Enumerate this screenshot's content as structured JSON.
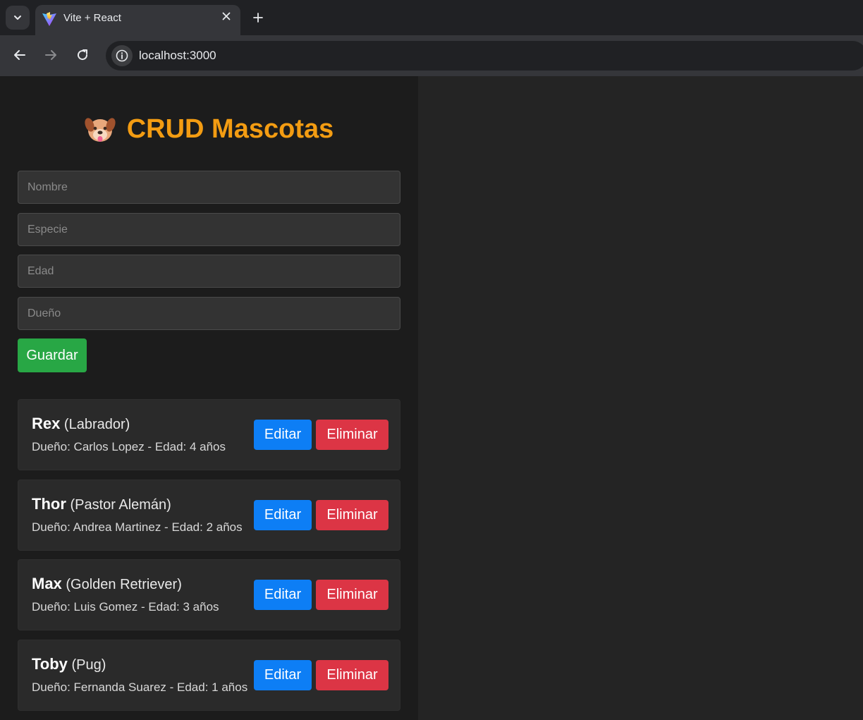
{
  "browser": {
    "tab_title": "Vite + React",
    "url": "localhost:3000",
    "icons": {
      "tab_search": "chevron-down-icon",
      "favicon": "vite-logo-icon",
      "close": "close-icon",
      "new_tab": "plus-icon",
      "back": "arrow-left-icon",
      "forward": "arrow-right-icon",
      "reload": "reload-icon",
      "site_info": "info-icon"
    }
  },
  "app": {
    "title": "CRUD Mascotas",
    "title_icon": "dog-face-emoji",
    "accent_color": "#f39c12",
    "form": {
      "nombre_placeholder": "Nombre",
      "especie_placeholder": "Especie",
      "edad_placeholder": "Edad",
      "dueno_placeholder": "Dueño",
      "save_label": "Guardar"
    },
    "pets": [
      {
        "name": "Rex",
        "species": "(Labrador)",
        "details": "Dueño: Carlos Lopez - Edad: 4 años",
        "edit_label": "Editar",
        "delete_label": "Eliminar"
      },
      {
        "name": "Thor",
        "species": "(Pastor Alemán)",
        "details": "Dueño: Andrea Martinez - Edad: 2 años",
        "edit_label": "Editar",
        "delete_label": "Eliminar"
      },
      {
        "name": "Max",
        "species": "(Golden Retriever)",
        "details": "Dueño: Luis Gomez - Edad: 3 años",
        "edit_label": "Editar",
        "delete_label": "Eliminar"
      },
      {
        "name": "Toby",
        "species": "(Pug)",
        "details": "Dueño: Fernanda Suarez - Edad: 1 años",
        "edit_label": "Editar",
        "delete_label": "Eliminar"
      }
    ]
  },
  "colors": {
    "save_button": "#28a745",
    "edit_button": "#0d7ef5",
    "delete_button": "#dc3545"
  }
}
